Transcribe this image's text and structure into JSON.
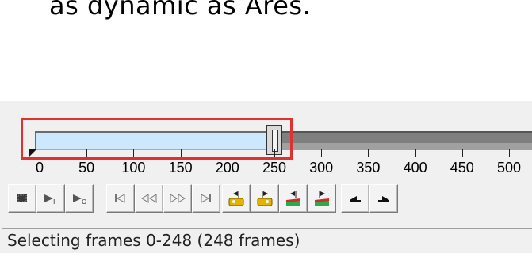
{
  "caption": {
    "text": "as dynamic as Ares."
  },
  "timeline": {
    "tick_labels": [
      "0",
      "50",
      "100",
      "150",
      "200",
      "250",
      "300",
      "350",
      "400",
      "450",
      "500"
    ],
    "selection_start_frame": 0,
    "selection_end_frame": 248
  },
  "toolbar": {
    "buttons": [
      {
        "name": "stop-icon"
      },
      {
        "name": "play-from-start-icon"
      },
      {
        "name": "play-selection-icon"
      },
      {
        "name": "first-frame-icon"
      },
      {
        "name": "step-back-icon"
      },
      {
        "name": "step-forward-icon"
      },
      {
        "name": "last-frame-icon"
      },
      {
        "name": "prev-keyframe-icon"
      },
      {
        "name": "next-keyframe-icon"
      },
      {
        "name": "prev-scene-icon"
      },
      {
        "name": "next-scene-icon"
      },
      {
        "name": "mark-in-icon"
      },
      {
        "name": "mark-out-icon"
      }
    ]
  },
  "status": {
    "text": "Selecting frames 0-248 (248 frames)"
  },
  "colors": {
    "selection_fill": "#cce8ff",
    "track_rest": "#7f7f7f",
    "highlight_border": "#e0302f"
  }
}
